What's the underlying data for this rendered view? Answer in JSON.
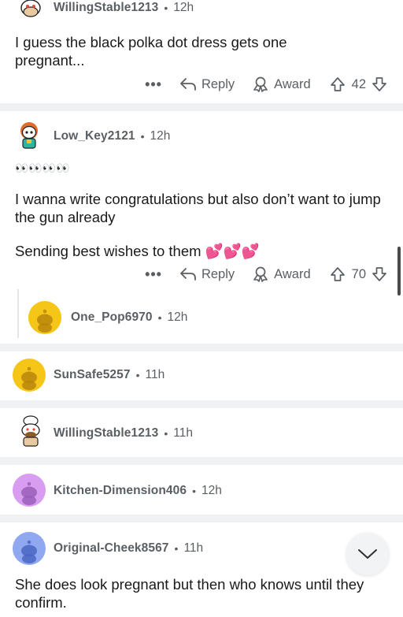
{
  "comments": [
    {
      "username": "WillingStable1213",
      "time": "12h",
      "body": "I guess the black polka dot dress gets one pregnant...",
      "actions": {
        "more": "•••",
        "reply": "Reply",
        "award": "Award",
        "votes": "42"
      }
    },
    {
      "username": "Low_Key2121",
      "time": "12h",
      "emoji_line": "👀👀👀👀",
      "body_1": "I wanna write congratulations but also don’t want to jump the gun already",
      "body_2": "Sending best wishes to them 💕💕💕",
      "actions": {
        "more": "•••",
        "reply": "Reply",
        "award": "Award",
        "votes": "70"
      }
    },
    {
      "username": "One_Pop6970",
      "time": "12h"
    },
    {
      "username": "SunSafe5257",
      "time": "11h"
    },
    {
      "username": "WillingStable1213",
      "time": "11h"
    },
    {
      "username": "Kitchen-Dimension406",
      "time": "12h"
    },
    {
      "username": "Original-Cheek8567",
      "time": "11h",
      "body": "She does look pregnant but then who knows until they confirm."
    }
  ],
  "separator": "•",
  "icons": {
    "more": "ellipsis-icon",
    "reply": "reply-arrow-icon",
    "award": "award-ribbon-icon",
    "upvote": "upvote-arrow-icon",
    "downvote": "downvote-arrow-icon",
    "fab": "chevron-down-icon"
  },
  "colors": {
    "avatar_yellow": "#f5c518",
    "avatar_purple": "#d89cf0",
    "avatar_blue": "#8fa8f0",
    "muted_text": "#5a5f63",
    "separator": "#f0f1f3"
  }
}
